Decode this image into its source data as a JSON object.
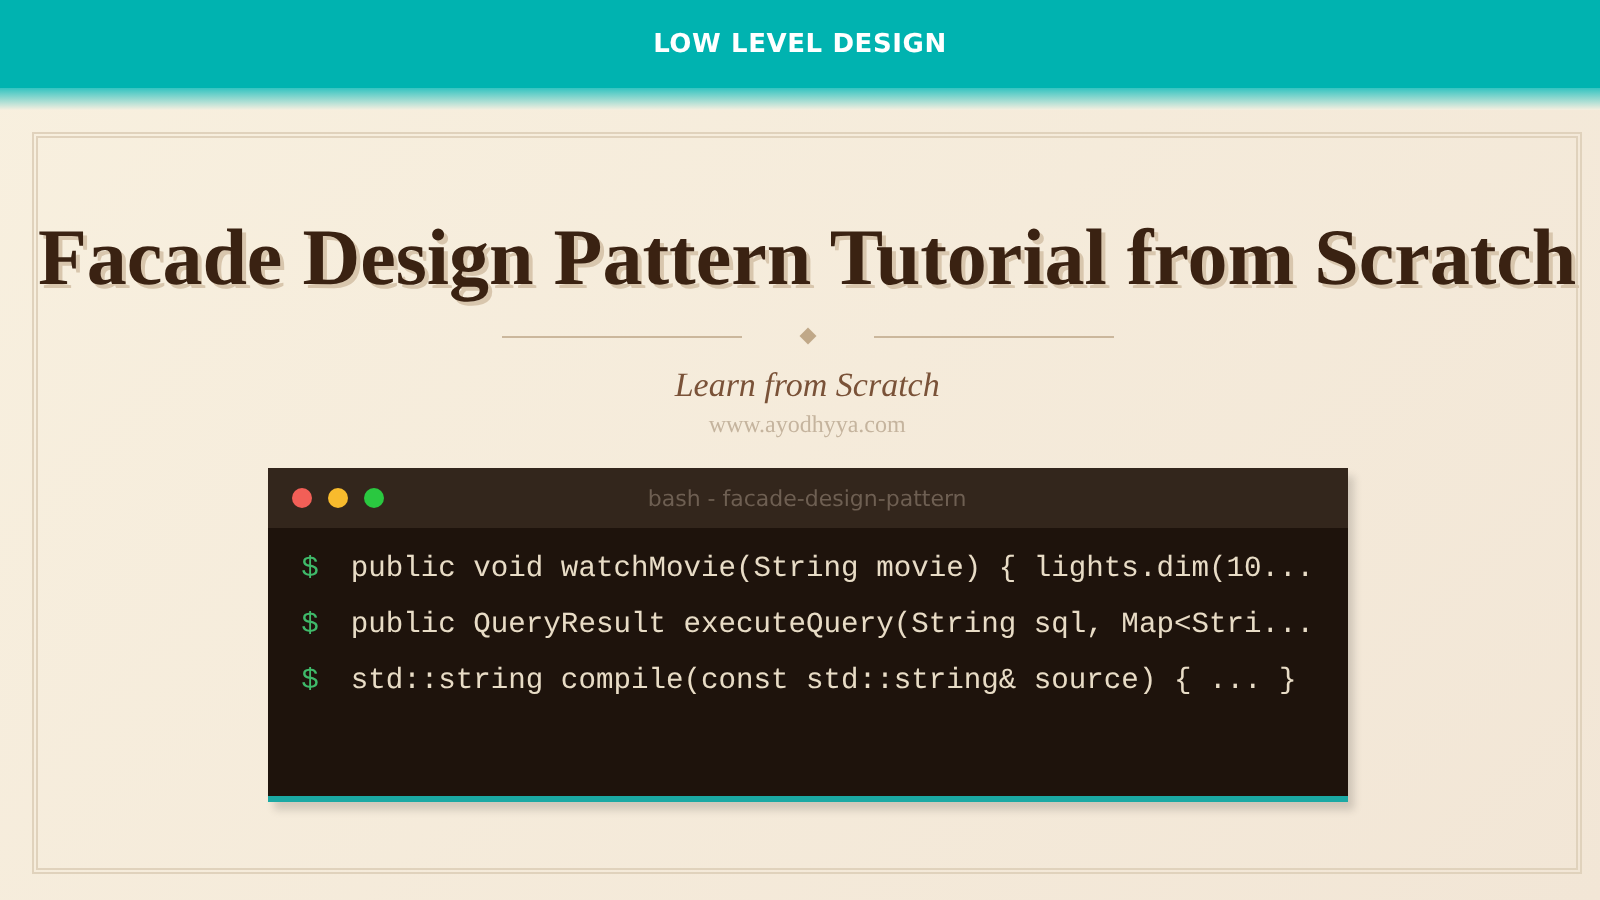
{
  "header": {
    "title": "LOW LEVEL DESIGN"
  },
  "hero": {
    "title": "Facade Design Pattern Tutorial from Scratch",
    "subtitle": "Learn from Scratch",
    "site": "www.ayodhyya.com"
  },
  "terminal": {
    "title": "bash - facade-design-pattern",
    "lines": [
      {
        "prompt": "$",
        "text": "public void watchMovie(String movie) { lights.dim(10..."
      },
      {
        "prompt": "$",
        "text": "public QueryResult executeQuery(String sql, Map<Stri..."
      },
      {
        "prompt": "$",
        "text": "std::string compile(const std::string& source) { ... }"
      }
    ]
  }
}
